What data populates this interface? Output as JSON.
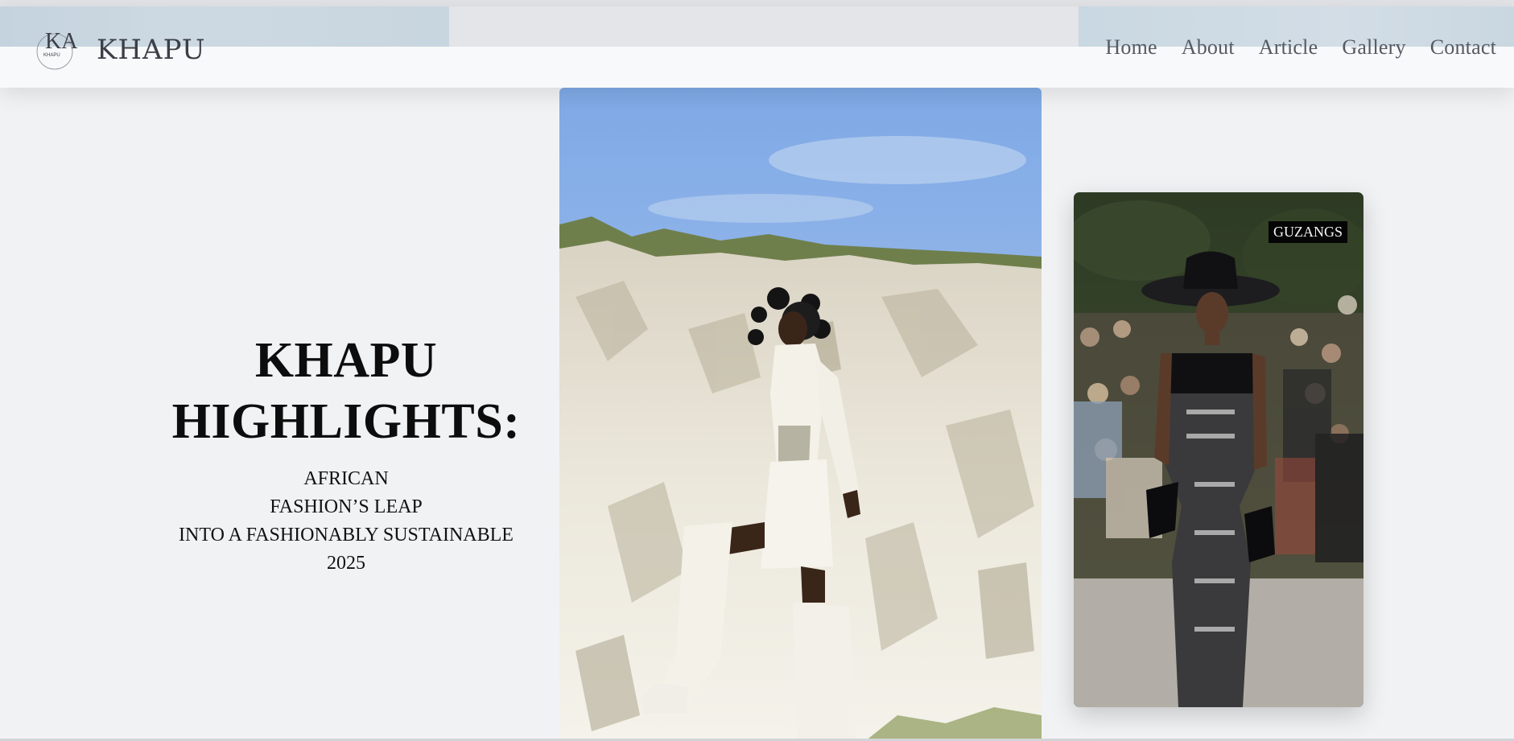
{
  "brand": {
    "name": "KHAPU",
    "mark_initials": "KA",
    "mark_small": "KHAPU"
  },
  "nav": {
    "items": [
      {
        "label": "Home"
      },
      {
        "label": "About"
      },
      {
        "label": "Article"
      },
      {
        "label": "Gallery"
      },
      {
        "label": "Contact"
      }
    ]
  },
  "hero": {
    "title_line1": "KHAPU",
    "title_line2": "HIGHLIGHTS:",
    "subtitle_lines": [
      "AFRICAN",
      "FASHION’S LEAP",
      "INTO A FASHIONABLY SUSTAINABLE",
      "2025"
    ]
  },
  "gallery": {
    "side_badge": "GUZANGS"
  },
  "colors": {
    "background": "#f1f2f4",
    "header": "#f8f9fa",
    "nav_text": "#555a63",
    "title_text": "#0d0d0d",
    "badge_bg": "#050505"
  }
}
